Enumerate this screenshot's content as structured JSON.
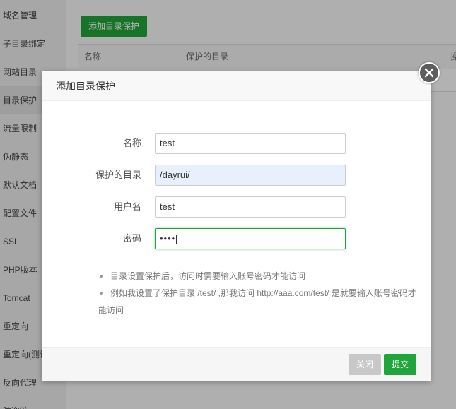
{
  "sidebar": {
    "items": [
      {
        "label": "域名管理"
      },
      {
        "label": "子目录绑定"
      },
      {
        "label": "网站目录"
      },
      {
        "label": "目录保护"
      },
      {
        "label": "流量限制"
      },
      {
        "label": "伪静态"
      },
      {
        "label": "默认文档"
      },
      {
        "label": "配置文件"
      },
      {
        "label": "SSL"
      },
      {
        "label": "PHP版本"
      },
      {
        "label": "Tomcat"
      },
      {
        "label": "重定向"
      },
      {
        "label": "重定向(测试"
      },
      {
        "label": "反向代理"
      },
      {
        "label": "防盗链"
      }
    ]
  },
  "main": {
    "add_button": "添加目录保护",
    "table": {
      "headers": [
        "名称",
        "保护的目录",
        "操"
      ]
    }
  },
  "dialog": {
    "title": "添加目录保护",
    "fields": {
      "name": {
        "label": "名称",
        "value": "test"
      },
      "dir": {
        "label": "保护的目录",
        "value": "/dayrui/"
      },
      "username": {
        "label": "用户名",
        "value": "test"
      },
      "password": {
        "label": "密码",
        "value": "••••"
      }
    },
    "tips": [
      "目录设置保护后，访问时需要输入账号密码才能访问",
      "例如我设置了保护目录 /test/ ,那我访问 http://aaa.com/test/ 是就要输入账号密码才能访问"
    ],
    "buttons": {
      "close": "关闭",
      "submit": "提交"
    }
  },
  "colors": {
    "accent": "#20a53a",
    "overlay": "rgba(0,0,0,0.3)",
    "close_circle": "#5d5d5d"
  },
  "icons": {
    "close": "close-icon"
  }
}
